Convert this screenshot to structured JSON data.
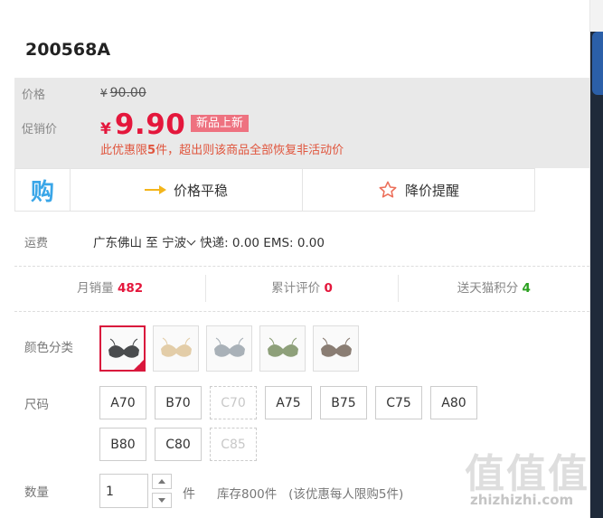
{
  "product": {
    "title": "200568A"
  },
  "price": {
    "original_label": "价格",
    "currency": "¥",
    "original_value": "90.00",
    "promo_label": "促销价",
    "promo_value": "9.90",
    "badge": "新品上新",
    "limit_note_prefix": "此优惠限",
    "limit_count": "5",
    "limit_note_suffix": "件，超出则该商品全部恢复非活动价"
  },
  "services": {
    "gou_icon": "购",
    "price_stable": "价格平稳",
    "price_alert": "降价提醒"
  },
  "shipping": {
    "label": "运费",
    "from": "广东佛山",
    "to_word": "至",
    "destination": "宁波",
    "fees": "快递: 0.00 EMS: 0.00"
  },
  "stats": {
    "monthly_sales_label": "月销量",
    "monthly_sales_value": "482",
    "reviews_label": "累计评价",
    "reviews_value": "0",
    "points_label": "送天猫积分",
    "points_value": "4"
  },
  "color": {
    "label": "颜色分类",
    "swatches": [
      {
        "color": "#4a4c4e",
        "selected": true
      },
      {
        "color": "#e3cda8",
        "selected": false
      },
      {
        "color": "#a9b1b8",
        "selected": false
      },
      {
        "color": "#8ea07a",
        "selected": false
      },
      {
        "color": "#8a7d73",
        "selected": false
      }
    ]
  },
  "size": {
    "label": "尺码",
    "options": [
      {
        "label": "A70",
        "available": true
      },
      {
        "label": "B70",
        "available": true
      },
      {
        "label": "C70",
        "available": false
      },
      {
        "label": "A75",
        "available": true
      },
      {
        "label": "B75",
        "available": true
      },
      {
        "label": "C75",
        "available": true
      },
      {
        "label": "A80",
        "available": true
      },
      {
        "label": "B80",
        "available": true
      },
      {
        "label": "C80",
        "available": true
      },
      {
        "label": "C85",
        "available": false
      }
    ]
  },
  "quantity": {
    "label": "数量",
    "value": "1",
    "unit": "件",
    "stock": "库存800件",
    "limit": "(该优惠每人限购5件)"
  },
  "watermark": {
    "glyphs": "值值值",
    "url": "zhizhizhi.com"
  },
  "colors": {
    "accent": "#e4173c",
    "badge": "#ee7280",
    "green": "#2aa01f"
  }
}
